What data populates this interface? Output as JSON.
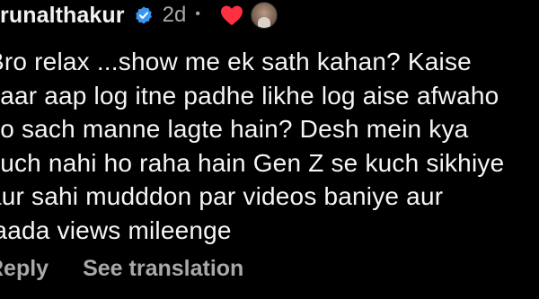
{
  "comment": {
    "username": "krunalthakur",
    "timestamp": "2d",
    "separator": "•",
    "text_lines": [
      "Bro relax ...show me ek sath kahan? Kaise",
      "yaar aap log itne padhe likhe log aise afwaho",
      "ko sach manne lagte hain? Desh mein  kya",
      "kuch nahi ho raha hain Gen Z se kuch sikhiye",
      "aur sahi mudddon par videos baniye aur",
      "jaada views mileenge"
    ],
    "actions": {
      "reply_label": "Reply",
      "translate_label": "See translation"
    }
  },
  "colors": {
    "background": "#000000",
    "text": "#f5f5f5",
    "secondary_text": "#a8a8a8",
    "verified_badge": "#3897f0",
    "heart": "#ff3040"
  },
  "icons": {
    "verified": "verified-badge-icon",
    "liked": "heart-icon"
  }
}
